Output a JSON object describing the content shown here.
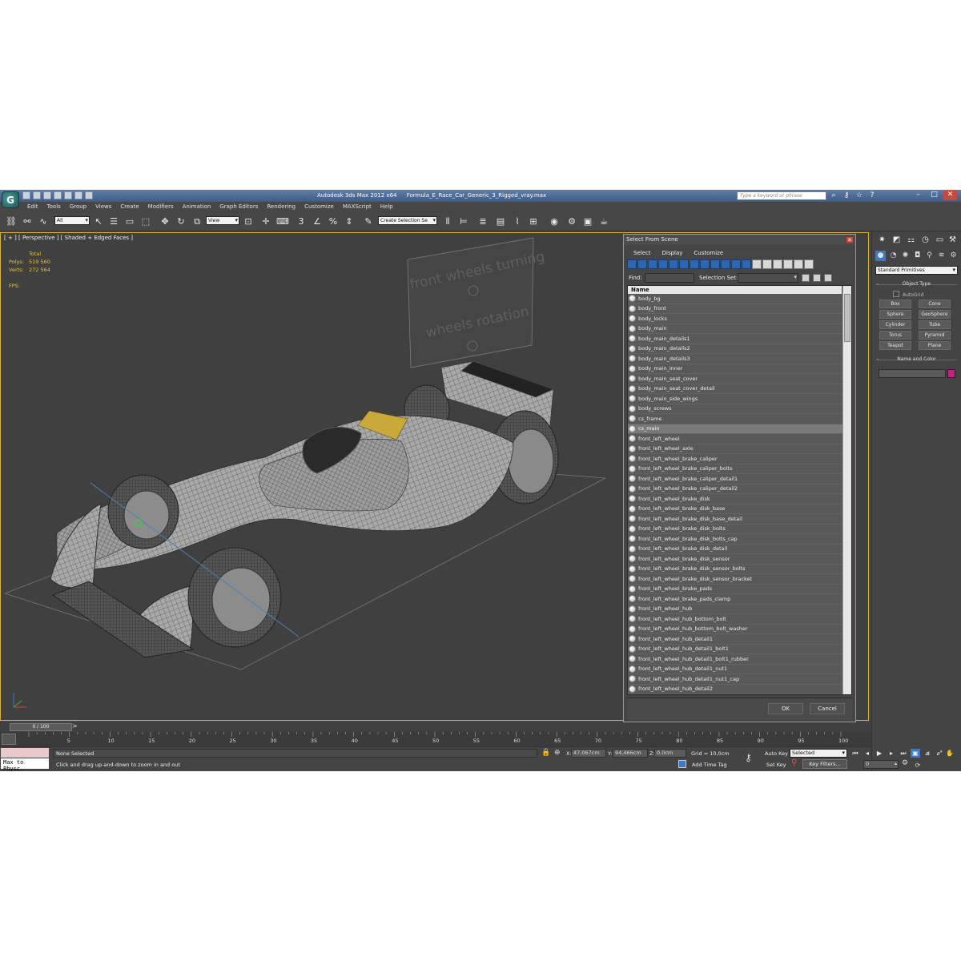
{
  "titlebar": {
    "app_name": "Autodesk 3ds Max  2012 x64",
    "file_name": "Formula_E_Race_Car_Generic_3_Rigged_vray.max",
    "search_placeholder": "Type a keyword or phrase"
  },
  "menu": [
    "Edit",
    "Tools",
    "Group",
    "Views",
    "Create",
    "Modifiers",
    "Animation",
    "Graph Editors",
    "Rendering",
    "Customize",
    "MAXScript",
    "Help"
  ],
  "toolbar": {
    "selection_filter": "All",
    "reference_coord": "View",
    "snap_angle": "3",
    "named_selection": "Create Selection Se"
  },
  "viewport": {
    "label": "[ + ] [ Perspective ] [ Shaded + Edged Faces ]",
    "stats_header": "Total",
    "polys_label": "Polys:",
    "polys_value": "519 560",
    "verts_label": "Verts:",
    "verts_value": "272 564",
    "fps_label": "FPS:",
    "sign_text_1": "front wheels turning",
    "sign_text_2": "wheels rotation"
  },
  "dialog": {
    "title": "Select From Scene",
    "menu": [
      "Select",
      "Display",
      "Customize"
    ],
    "find_label": "Find:",
    "selection_set_label": "Selection Set:",
    "column_header": "Name",
    "items": [
      "body_bg",
      "body_front",
      "body_locks",
      "body_main",
      "body_main_details1",
      "body_main_details2",
      "body_main_details3",
      "body_main_inner",
      "body_main_seat_cover",
      "body_main_seat_cover_detail",
      "body_main_side_wings",
      "body_screws",
      "cs_frame",
      "cs_main",
      "front_left_wheel",
      "front_left_wheel_axle",
      "front_left_wheel_brake_caliper",
      "front_left_wheel_brake_caliper_bolts",
      "front_left_wheel_brake_caliper_detail1",
      "front_left_wheel_brake_caliper_detail2",
      "front_left_wheel_brake_disk",
      "front_left_wheel_brake_disk_base",
      "front_left_wheel_brake_disk_base_detail",
      "front_left_wheel_brake_disk_bolts",
      "front_left_wheel_brake_disk_bolts_cap",
      "front_left_wheel_brake_disk_detail",
      "front_left_wheel_brake_disk_sensor",
      "front_left_wheel_brake_disk_sensor_bolts",
      "front_left_wheel_brake_disk_sensor_bracket",
      "front_left_wheel_brake_pads",
      "front_left_wheel_brake_pads_clamp",
      "front_left_wheel_hub",
      "front_left_wheel_hub_bottom_bolt",
      "front_left_wheel_hub_bottom_bolt_washer",
      "front_left_wheel_hub_detail1",
      "front_left_wheel_hub_detail1_bolt1",
      "front_left_wheel_hub_detail1_bolt1_rubber",
      "front_left_wheel_hub_detail1_nut1",
      "front_left_wheel_hub_detail1_nut1_cap",
      "front_left_wheel_hub_detail2"
    ],
    "selected_item": "cs_main",
    "ok": "OK",
    "cancel": "Cancel"
  },
  "command_panel": {
    "category": "Standard Primitives",
    "object_type_title": "Object Type",
    "autogrid": "AutoGrid",
    "buttons": [
      "Box",
      "Cone",
      "Sphere",
      "GeoSphere",
      "Cylinder",
      "Tube",
      "Torus",
      "Pyramid",
      "Teapot",
      "Plane"
    ],
    "name_color_title": "Name and Color",
    "object_color": "#c2237e"
  },
  "timeline": {
    "slider_label": "0 / 100",
    "ticks": [
      "0",
      "5",
      "10",
      "15",
      "20",
      "25",
      "30",
      "35",
      "40",
      "45",
      "50",
      "55",
      "60",
      "65",
      "70",
      "75",
      "80",
      "85",
      "90",
      "95",
      "100"
    ]
  },
  "status": {
    "maxscript_output": "Max to Physc.",
    "selection_msg": "None Selected",
    "prompt": "Click and drag up-and-down to zoom in and out",
    "x_label": "X:",
    "x_value": "47,067cm",
    "y_label": "Y:",
    "y_value": "94,466cm",
    "z_label": "Z:",
    "z_value": "0,0cm",
    "grid": "Grid = 10,0cm",
    "add_time_tag": "Add Time Tag",
    "auto_key": "Auto Key",
    "auto_key_mode": "Selected",
    "set_key": "Set Key",
    "key_filters": "Key Filters...",
    "current_frame": "0"
  }
}
